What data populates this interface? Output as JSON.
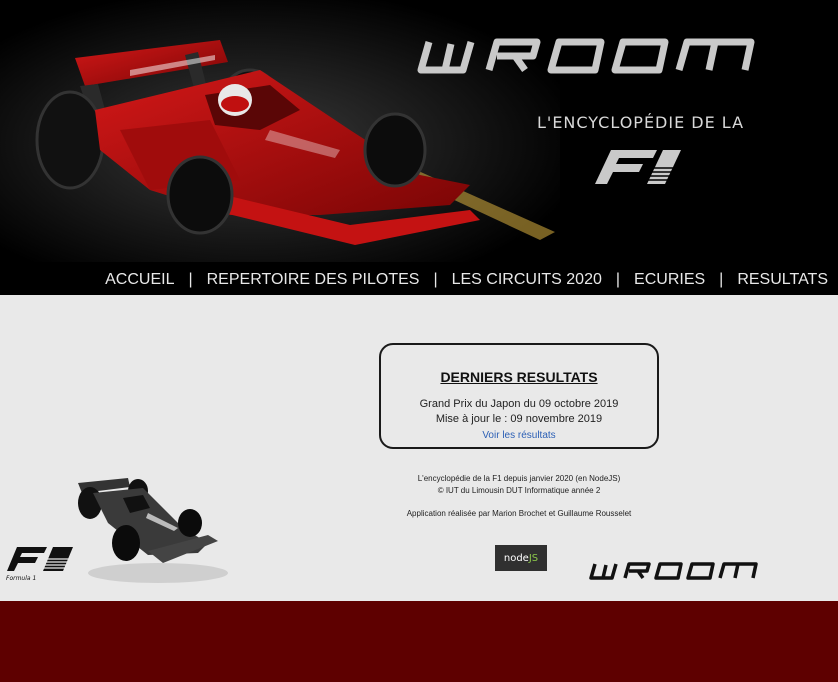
{
  "header": {
    "logo_alt": "WROOM",
    "tagline": "L'ENCYCLOPÉDIE DE LA",
    "f1_logo_alt": "F1"
  },
  "nav": {
    "items": [
      {
        "label": "ACCUEIL"
      },
      {
        "label": "REPERTOIRE DES PILOTES"
      },
      {
        "label": "LES CIRCUITS 2020"
      },
      {
        "label": "ECURIES"
      },
      {
        "label": "RESULTATS"
      }
    ],
    "separator": "|"
  },
  "results": {
    "title": "DERNIERS RESULTATS",
    "grand_prix": "Grand Prix du Japon du 09 octobre 2019",
    "updated": "Mise à jour le : 09 novembre 2019",
    "link": "Voir les résultats"
  },
  "footer": {
    "line1": "L'encyclopédie de la F1 depuis janvier 2020 (en NodeJS)",
    "line2": "© IUT du Limousin DUT Informatique année 2",
    "credits": "Application réalisée par Marion Brochet et Guillaume Rousselet",
    "nodejs_badge_node": "node",
    "nodejs_badge_js": "JS",
    "f1_small_caption": "Formula 1"
  },
  "colors": {
    "header_bg": "#000000",
    "content_bg": "#e9e9e9",
    "bottom_bg": "#5e0000",
    "link": "#2b5fb5",
    "car_red": "#b01010"
  },
  "icons": [
    "wroom-logo",
    "f1-logo",
    "ferrari-car-image",
    "f1-car-image",
    "nodejs-logo"
  ]
}
